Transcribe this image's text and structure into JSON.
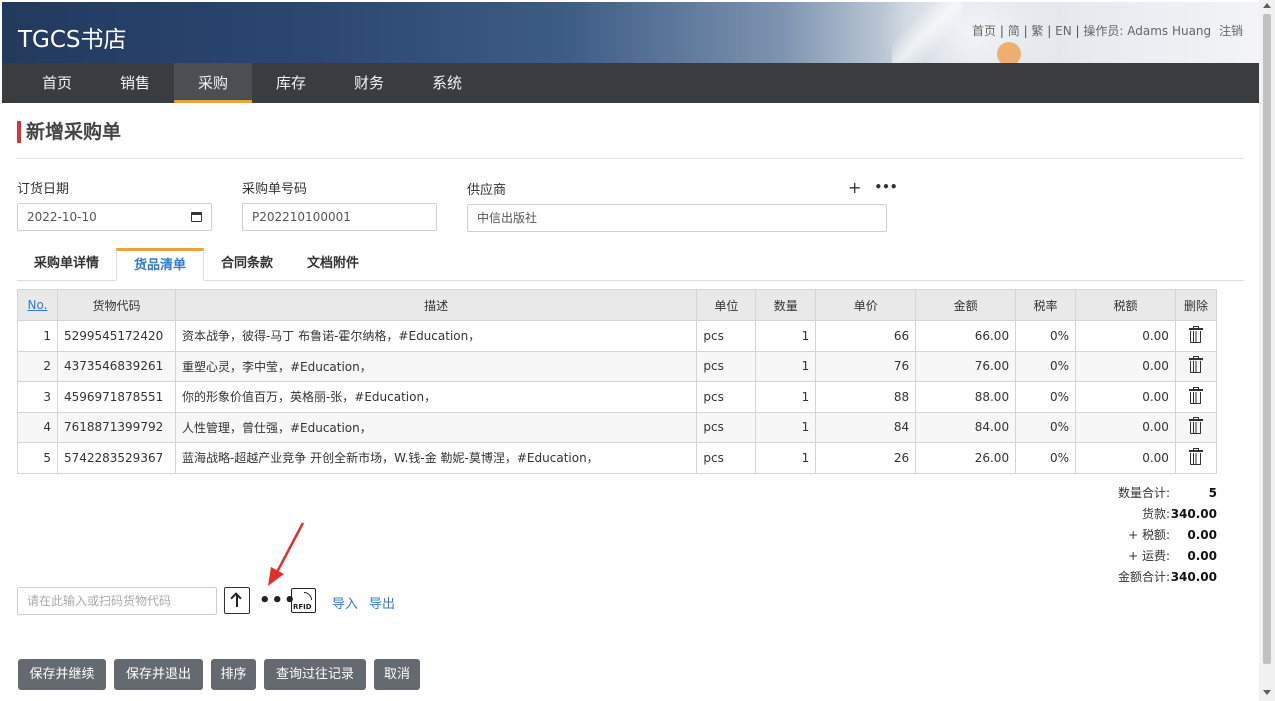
{
  "header": {
    "brand": "TGCS书店",
    "links": {
      "home": "首页",
      "simplified": "简",
      "traditional": "繁",
      "english": "EN",
      "operator_label": "操作员:",
      "operator_name": "Adams Huang",
      "logout": "注销"
    }
  },
  "nav": {
    "items": [
      {
        "label": "首页"
      },
      {
        "label": "销售"
      },
      {
        "label": "采购"
      },
      {
        "label": "库存"
      },
      {
        "label": "财务"
      },
      {
        "label": "系统"
      }
    ],
    "active_index": 2
  },
  "page": {
    "title": "新增采购单",
    "accent_color": "#d7343f"
  },
  "form": {
    "order_date": {
      "label": "订货日期",
      "value": "2022-10-10"
    },
    "po_number": {
      "label": "采购单号码",
      "value": "P202210100001"
    },
    "supplier": {
      "label": "供应商",
      "value": "中信出版社"
    },
    "icons": [
      "plus-icon",
      "more-icon"
    ]
  },
  "tabs": [
    {
      "label": "采购单详情"
    },
    {
      "label": "货品清单"
    },
    {
      "label": "合同条款"
    },
    {
      "label": "文档附件"
    }
  ],
  "table": {
    "headers": [
      "No.",
      "货物代码",
      "描述",
      "单位",
      "数量",
      "单价",
      "金额",
      "税率",
      "税额",
      "删除"
    ],
    "rows": [
      {
        "no": "1",
        "code": "5299545172420",
        "desc": "资本战争，彼得-马丁 布鲁诺-霍尔纳格，#Education，",
        "unit": "pcs",
        "qty": "1",
        "price": "66",
        "amount": "66.00",
        "tax_rate": "0%",
        "tax": "0.00"
      },
      {
        "no": "2",
        "code": "4373546839261",
        "desc": "重塑心灵，李中莹，#Education，",
        "unit": "pcs",
        "qty": "1",
        "price": "76",
        "amount": "76.00",
        "tax_rate": "0%",
        "tax": "0.00"
      },
      {
        "no": "3",
        "code": "4596971878551",
        "desc": "你的形象价值百万，英格丽-张，#Education，",
        "unit": "pcs",
        "qty": "1",
        "price": "88",
        "amount": "88.00",
        "tax_rate": "0%",
        "tax": "0.00"
      },
      {
        "no": "4",
        "code": "7618871399792",
        "desc": "人性管理，曾仕强，#Education，",
        "unit": "pcs",
        "qty": "1",
        "price": "84",
        "amount": "84.00",
        "tax_rate": "0%",
        "tax": "0.00"
      },
      {
        "no": "5",
        "code": "5742283529367",
        "desc": "蓝海战略-超越产业竞争 开创全新市场，W.钱-金 勒妮-莫博涅，#Education，",
        "unit": "pcs",
        "qty": "1",
        "price": "26",
        "amount": "26.00",
        "tax_rate": "0%",
        "tax": "0.00"
      }
    ]
  },
  "totals": {
    "qty_label": "数量合计:",
    "qty": "5",
    "goods_label": "货款:",
    "goods": "340.00",
    "tax_label": "+ 税额:",
    "tax": "0.00",
    "freight_label": "+ 运费:",
    "freight": "0.00",
    "grand_label": "金额合计:",
    "grand": "340.00"
  },
  "scan": {
    "placeholder": "请在此输入或扫码货物代码",
    "more": "•••",
    "rfid": "RFID",
    "import": "导入",
    "export": "导出"
  },
  "buttons": {
    "save_continue": "保存并继续",
    "save_exit": "保存并退出",
    "sort": "排序",
    "history": "查询过往记录",
    "cancel": "取消"
  },
  "colors": {
    "nav_bg": "#3a3d40",
    "tab_accent": "#e8a33d",
    "link": "#2f7bd0",
    "button_bg": "#646a70",
    "annotation_arrow": "#e0302a"
  }
}
